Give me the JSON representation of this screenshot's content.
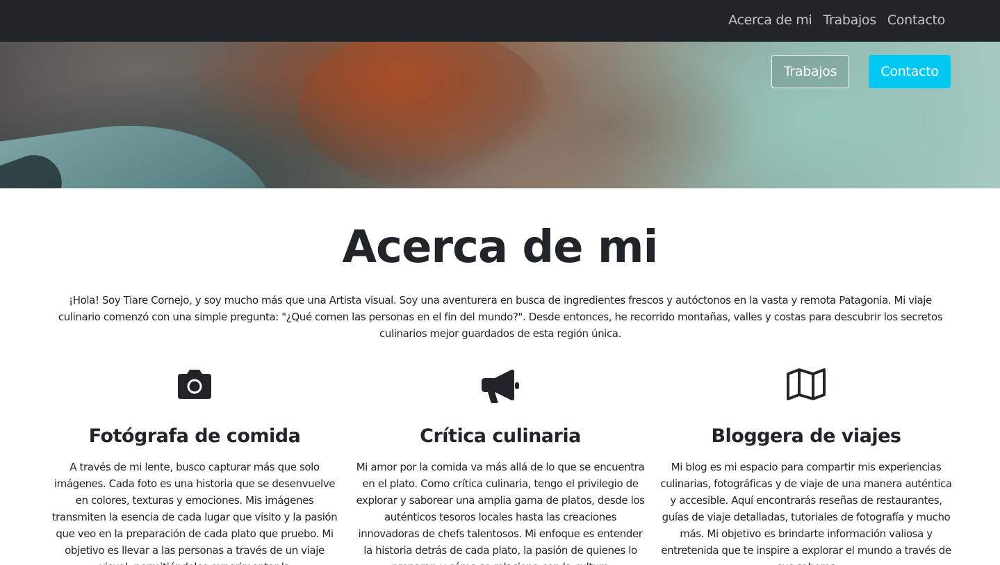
{
  "navbar": {
    "links": [
      "Acerca de mi",
      "Trabajos",
      "Contacto"
    ]
  },
  "hero": {
    "buttons": {
      "secondary": "Trabajos",
      "primary": "Contacto"
    },
    "colors": {
      "primary": "#00c8f0",
      "navbar": "#212529"
    }
  },
  "about": {
    "title": "Acerca de mi",
    "intro": "¡Hola! Soy Tiare Cornejo, y soy mucho más que una Artista visual. Soy una aventurera en busca de ingredientes frescos y autóctonos en la vasta y remota Patagonia. Mi viaje culinario comenzó con una simple pregunta: \"¿Qué comen las personas en el fin del mundo?\". Desde entonces, he recorrido montañas, valles y costas para descubrir los secretos culinarios mejor guardados de esta región única.",
    "features": [
      {
        "icon": "camera-icon",
        "title": "Fotógrafa de comida",
        "text": "A través de mi lente, busco capturar más que solo imágenes. Cada foto es una historia que se desenvuelve en colores, texturas y emociones. Mis imágenes transmiten la esencia de cada lugar que visito y la pasión que veo en la preparación de cada plato que pruebo. Mi objetivo es llevar a las personas a través de un viaje visual, permitiéndoles experimentar la"
      },
      {
        "icon": "megaphone-icon",
        "title": "Crítica culinaria",
        "text": "Mi amor por la comida va más allá de lo que se encuentra en el plato. Como crítica culinaria, tengo el privilegio de explorar y saborear una amplia gama de platos, desde los auténticos tesoros locales hasta las creaciones innovadoras de chefs talentosos. Mi enfoque es entender la historia detrás de cada plato, la pasión de quienes lo preparan y cómo se relaciona con la cultura"
      },
      {
        "icon": "map-icon",
        "title": "Bloggera de viajes",
        "text": "Mi blog es mi espacio para compartir mis experiencias culinarias, fotográficas y de viaje de una manera auténtica y accesible. Aquí encontrarás reseñas de restaurantes, guías de viaje detalladas, tutoriales de fotografía y mucho más. Mi objetivo es brindarte información valiosa y entretenida que te inspire a explorar el mundo a través de sus sabores"
      }
    ]
  }
}
